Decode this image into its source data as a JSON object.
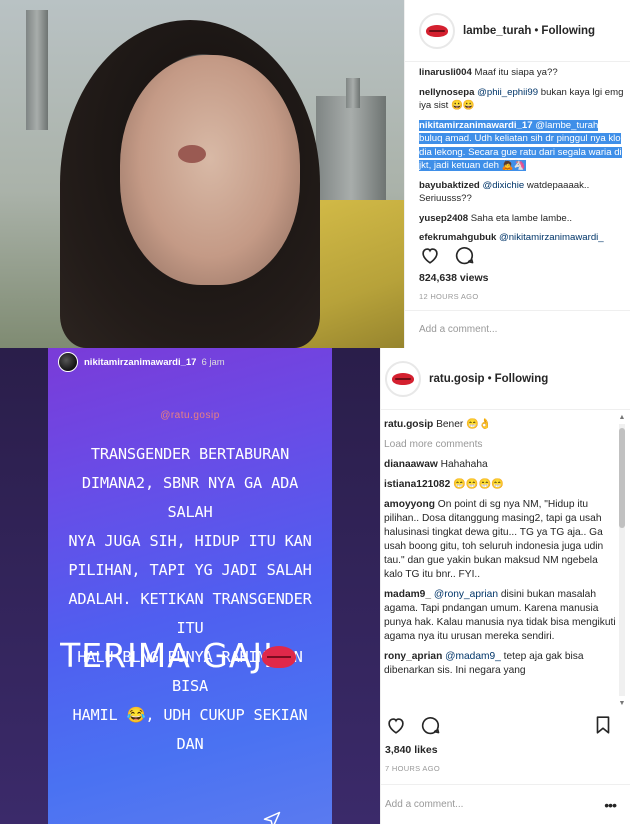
{
  "top": {
    "header": {
      "username": "lambe_turah",
      "separator": "•",
      "follow": "Following"
    },
    "comments": [
      {
        "user": "linarusli004",
        "text": "Maaf itu siapa ya??"
      },
      {
        "user": "nellynosepa",
        "mention": "@phii_ephii99",
        "text": "bukan kaya lgi emg iya sist 😀😀"
      },
      {
        "user": "nikitamirzanimawardi_17",
        "mention": "@lambe_turah",
        "text": "buluq amad. Udh keliatan sih dr pinggul nya klo dia lekong. Secara gue ratu dari segala waria di jkt, jadi ketuan deh 🙇🦄",
        "highlighted": true
      },
      {
        "user": "bayubaktized",
        "mention": "@dixichie",
        "text": "watdepaaaak.. Seriuusss??"
      },
      {
        "user": "yusep2408",
        "text": "Saha eta lambe lambe.."
      },
      {
        "user": "efekrumahgubuk",
        "mention": "@nikitamirzanimawardi_"
      }
    ],
    "views": "824,638 views",
    "time": "12 HOURS AGO",
    "add_comment": "Add a comment..."
  },
  "story": {
    "username": "nikitamirzanimawardi_17",
    "time": "6 jam",
    "tag": "@ratu.gosip",
    "body_lines": [
      "TRANSGENDER BERTABURAN",
      "DIMANA2, SBNR NYA GA ADA SALAH",
      "NYA JUGA SIH, HIDUP ITU KAN",
      "PILIHAN, TAPI YG JADI SALAH",
      "ADALAH. KETIKAN TRANSGENDER ITU",
      "HALU BLNG PUNYA RAHIM DAN BISA",
      "HAMIL 😂, UDH CUKUP SEKIAN DAN"
    ],
    "big_text": "TERIMA GAJI"
  },
  "bottom": {
    "header": {
      "username": "ratu.gosip",
      "separator": "•",
      "follow": "Following"
    },
    "first_comment": {
      "user": "ratu.gosip",
      "text": "Bener 😁👌"
    },
    "load_more": "Load more comments",
    "comments": [
      {
        "user": "dianaawaw",
        "text": "Hahahaha"
      },
      {
        "user": "istiana121082",
        "text": "😁😁😁😁"
      },
      {
        "user": "amoyyong",
        "text": "On point di sg nya NM, \"Hidup itu pilihan.. Dosa ditanggung masing2, tapi ga usah halusinasi tingkat dewa gitu... TG ya TG aja.. Ga usah boong gitu, toh seluruh indonesia juga udin tau.\" dan gue yakin bukan maksud NM ngebela kalo TG itu bnr.. FYI.."
      },
      {
        "user": "madam9_",
        "mention": "@rony_aprian",
        "text": "disini bukan masalah agama. Tapi pndangan umum. Karena manusia punya hak. Kalau manusia nya tidak bisa mengikuti agama nya itu urusan mereka sendiri."
      },
      {
        "user": "rony_aprian",
        "mention": "@madam9_",
        "text": "tetep aja gak bisa dibenarkan sis. Ini negara yang"
      }
    ],
    "likes": "3,840 likes",
    "time": "7 HOURS AGO",
    "add_comment": "Add a comment...",
    "more": "•••"
  }
}
